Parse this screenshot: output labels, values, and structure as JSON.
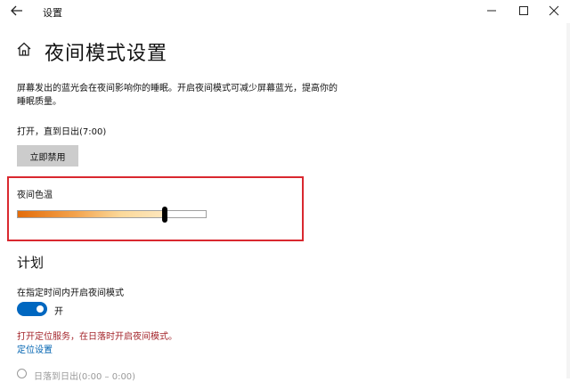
{
  "window": {
    "title": "设置",
    "back_icon": "back-arrow-icon",
    "controls": [
      "minimize-icon",
      "maximize-icon",
      "close-icon"
    ]
  },
  "page": {
    "title": "夜间模式设置",
    "home_icon": "home-icon",
    "description": "屏幕发出的蓝光会在夜间影响你的睡眠。开启夜间模式可减少屏幕蓝光，提高你的睡眠质量。",
    "status": "打开，直到日出(7:00)",
    "disable_button": "立即禁用"
  },
  "color_temperature": {
    "label": "夜间色温",
    "level": 0.78,
    "highlight_color": "#d9282f",
    "gradient": [
      "#e36c0a",
      "#fbd99a",
      "#fff3df"
    ]
  },
  "schedule": {
    "heading": "计划",
    "toggle_label": "在指定时间内开启夜间模式",
    "toggle_state": "开",
    "toggle_on": true,
    "accent": "#0067c0",
    "warning": "打开定位服务，在日落时开启夜间模式。",
    "warning_color": "#a4262c",
    "location_link": "定位设置",
    "option_sunset": "日落到日出(0:00 – 0:00)"
  }
}
